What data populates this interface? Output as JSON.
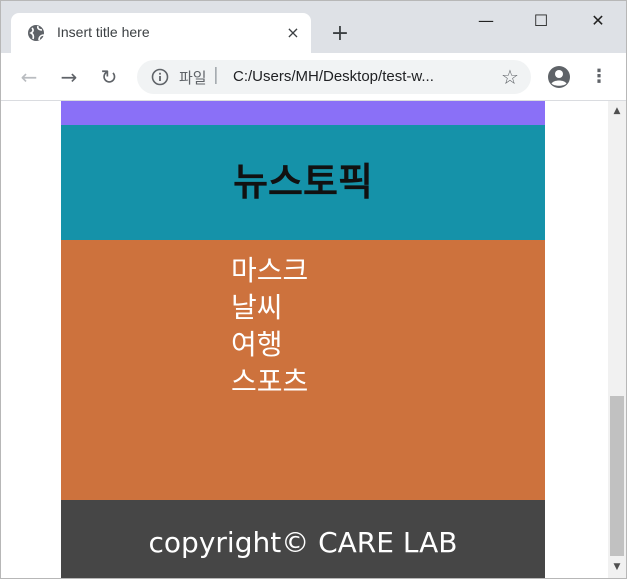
{
  "browser": {
    "tab": {
      "title": "Insert title here",
      "close_icon": "×",
      "favicon": "globe-icon"
    },
    "new_tab_icon": "+",
    "window_controls": {
      "minimize": "—",
      "maximize": "☐",
      "close": "✕"
    },
    "toolbar": {
      "back_icon": "←",
      "forward_icon": "→",
      "reload_icon": "↻",
      "site_info_label": "파일",
      "separator": "|",
      "url": "C:/Users/MH/Desktop/test-w...",
      "bookmark_icon": "☆",
      "menu_icon": "⋮"
    }
  },
  "page": {
    "colors": {
      "nav": "#8a70f7",
      "header": "#1592a9",
      "content": "#cd723d",
      "footer": "#464646"
    },
    "header": {
      "title": "뉴스토픽"
    },
    "topics": [
      "마스크",
      "날씨",
      "여행",
      "스포츠"
    ],
    "footer": {
      "text": "copyright© CARE LAB"
    }
  },
  "scrollbar": {
    "up_icon": "▲",
    "down_icon": "▼"
  }
}
